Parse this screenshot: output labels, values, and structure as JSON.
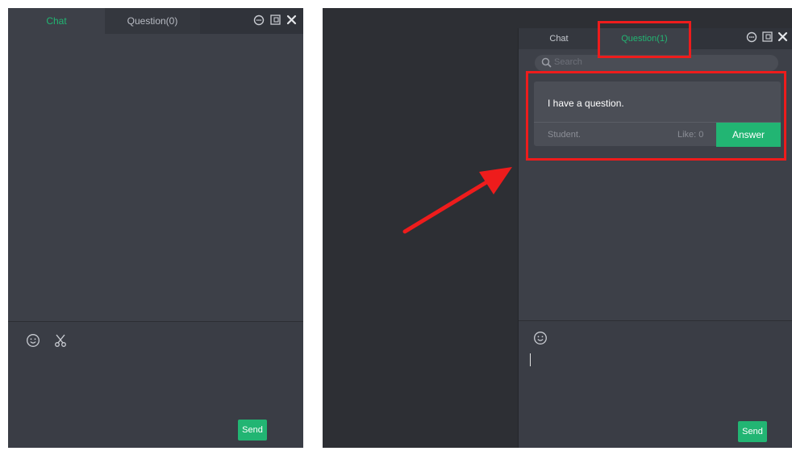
{
  "left_panel": {
    "tabs": [
      {
        "label": "Chat",
        "active": true
      },
      {
        "label": "Question(0)",
        "active": false
      }
    ],
    "window_icons": [
      "chat-bubble-icon",
      "popout-icon",
      "close-icon"
    ],
    "input_tools": [
      "emoji-icon",
      "scissors-icon"
    ],
    "send_label": "Send"
  },
  "right_panel": {
    "tabs": [
      {
        "label": "Chat",
        "active": false
      },
      {
        "label": "Question(1)",
        "active": true
      }
    ],
    "window_icons": [
      "chat-bubble-icon",
      "popout-icon",
      "close-icon"
    ],
    "search": {
      "placeholder": "Search"
    },
    "question": {
      "text": "I have a question.",
      "author": "Student.",
      "like": "Like: 0",
      "answer_label": "Answer"
    },
    "input_tools": [
      "emoji-icon"
    ],
    "send_label": "Send"
  },
  "colors": {
    "accent": "#22b573",
    "panel_bg": "#3d4048",
    "highlight": "#ee1c1c"
  }
}
